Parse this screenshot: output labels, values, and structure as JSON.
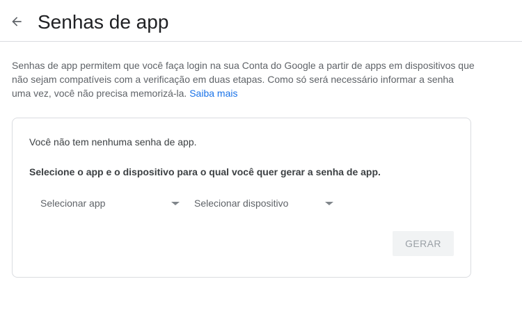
{
  "header": {
    "back_icon": "arrow-back-icon",
    "title": "Senhas de app"
  },
  "intro": {
    "text": "Senhas de app permitem que você faça login na sua Conta do Google a partir de apps em dispositivos que não sejam compatíveis com a verificação em duas etapas. Como só será necessário informar a senha uma vez, você não precisa memorizá-la.",
    "learn_more": "Saiba mais"
  },
  "card": {
    "empty_message": "Você não tem nenhuma senha de app.",
    "instruction": "Selecione o app e o dispositivo para o qual você quer gerar a senha de app.",
    "select_app": "Selecionar app",
    "select_device": "Selecionar dispositivo",
    "generate_label": "GERAR"
  },
  "colors": {
    "link": "#1a73e8",
    "border": "#dadce0",
    "disabled_button_bg": "#f1f3f4",
    "disabled_button_text": "#9aa0a6"
  }
}
